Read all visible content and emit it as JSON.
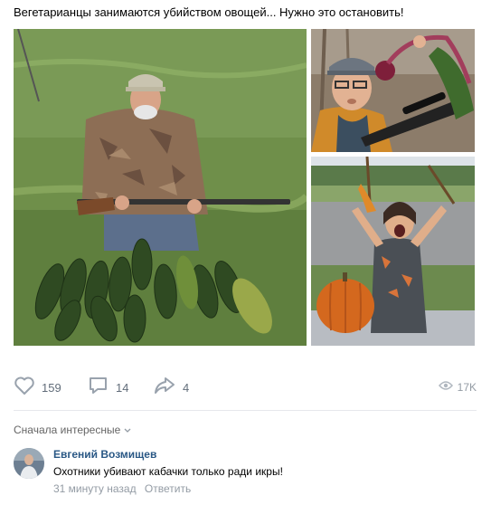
{
  "post": {
    "text": "Вегетарианцы занимаются убийством овощей... Нужно это остановить!",
    "photos": [
      {
        "subject": "hunter-with-zucchini"
      },
      {
        "subject": "man-with-rifle-and-beets"
      },
      {
        "subject": "girl-with-pumpkin"
      }
    ]
  },
  "actions": {
    "likes": "159",
    "comments": "14",
    "shares": "4",
    "views": "17K"
  },
  "comments": {
    "sort_label": "Сначала интересные",
    "items": [
      {
        "author": "Евгений Возмищев",
        "text": "Охотники убивают кабачки только ради икры!",
        "time": "31 минуту назад",
        "reply_label": "Ответить"
      }
    ]
  },
  "colors": {
    "link": "#2a5885",
    "icon": "#99a2ad",
    "muted": "#939ba4"
  }
}
